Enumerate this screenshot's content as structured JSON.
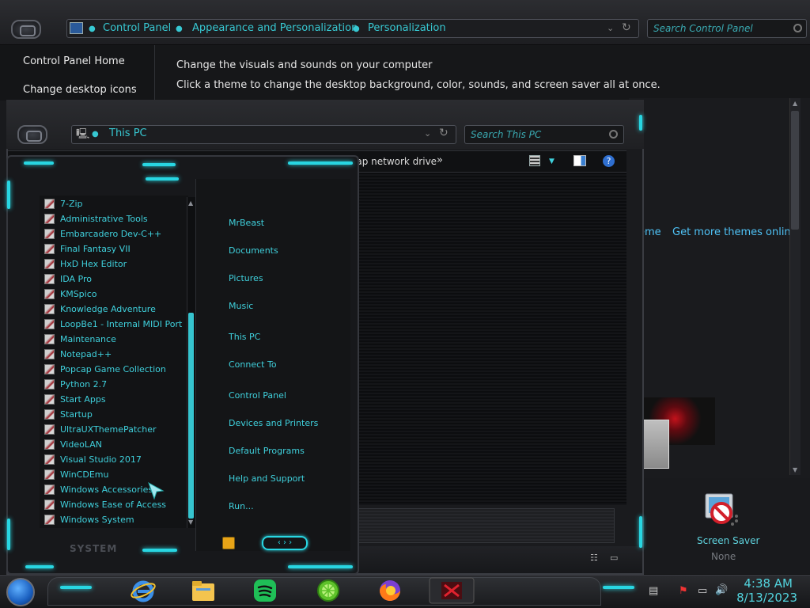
{
  "control_panel": {
    "breadcrumb": [
      "Control Panel",
      "Appearance and Personalization",
      "Personalization"
    ],
    "search_placeholder": "Search Control Panel",
    "sidebar": [
      "Control Panel Home",
      "Change desktop icons"
    ],
    "heading": "Change the visuals and sounds on your computer",
    "description": "Click a theme to change the desktop background, color, sounds, and screen saver all at once.",
    "theme_link_partial": "eme",
    "get_more_themes": "Get more themes online",
    "screen_saver_label": "Screen Saver",
    "screen_saver_value": "None"
  },
  "explorer": {
    "address": "This PC",
    "search_placeholder": "Search This PC",
    "toolbar_partial": "Map network drive",
    "toolbar_more": "»"
  },
  "start_menu": {
    "programs": [
      "7-Zip",
      "Administrative Tools",
      "Embarcadero Dev-C++",
      "Final Fantasy VII",
      "HxD Hex Editor",
      "IDA Pro",
      "KMSpico",
      "Knowledge Adventure",
      "LoopBe1 - Internal MIDI Port",
      "Maintenance",
      "Notepad++",
      "Popcap Game Collection",
      "Python 2.7",
      "Start Apps",
      "Startup",
      "UltraUXThemePatcher",
      "VideoLAN",
      "Visual Studio 2017",
      "WinCDEmu",
      "Windows Accessories",
      "Windows Ease of Access",
      "Windows System"
    ],
    "right_items": [
      "MrBeast",
      "Documents",
      "Pictures",
      "Music",
      "This PC",
      "Connect To",
      "Control Panel",
      "Devices and Printers",
      "Default Programs",
      "Help and Support",
      "Run..."
    ],
    "system_label": "SYSTEM"
  },
  "taskbar": {
    "time": "4:38 AM",
    "date": "8/13/2023",
    "apps": [
      "internet-explorer-icon",
      "file-explorer-icon",
      "spotify-icon",
      "lime-icon",
      "firefox-icon",
      "game-icon"
    ]
  },
  "colors": {
    "accent": "#28d6e2",
    "text_cyan": "#3fd0dc"
  }
}
